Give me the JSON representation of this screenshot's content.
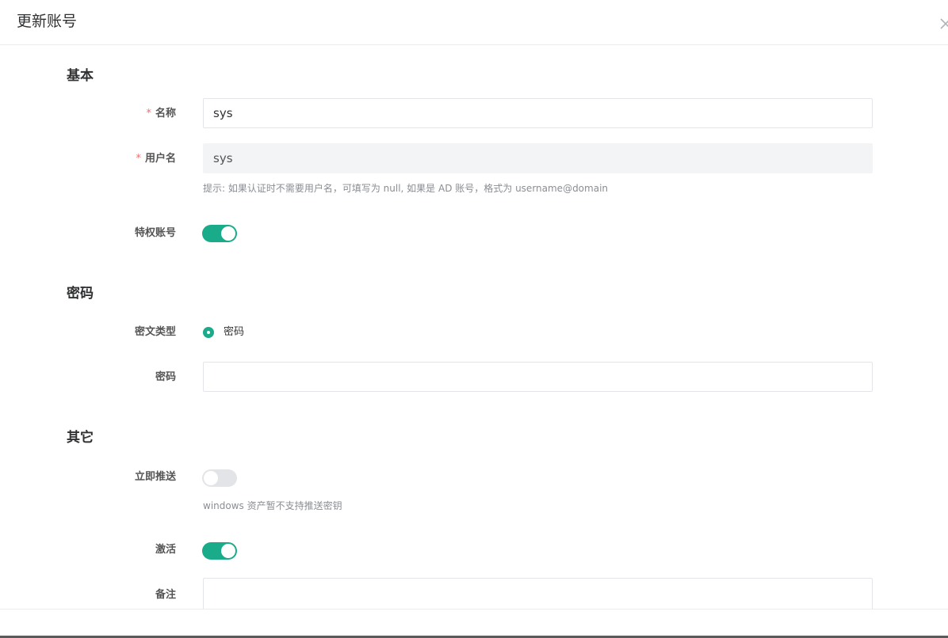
{
  "dialog": {
    "title": "更新账号"
  },
  "sections": {
    "basic": {
      "title": "基本",
      "name": {
        "label": "名称",
        "value": "sys",
        "required": "*"
      },
      "username": {
        "label": "用户名",
        "value": "sys",
        "required": "*",
        "hint": "提示: 如果认证时不需要用户名，可填写为 null, 如果是 AD 账号，格式为 username@domain"
      },
      "privileged": {
        "label": "特权账号",
        "on": true
      }
    },
    "password": {
      "title": "密码",
      "secret_type": {
        "label": "密文类型",
        "option": "密码"
      },
      "password": {
        "label": "密码",
        "value": ""
      }
    },
    "other": {
      "title": "其它",
      "push_now": {
        "label": "立即推送",
        "on": false,
        "hint": "windows 资产暂不支持推送密钥"
      },
      "active": {
        "label": "激活",
        "on": true
      },
      "comment": {
        "label": "备注",
        "value": ""
      }
    }
  },
  "colors": {
    "accent": "#1aab8a",
    "required": "#f56c6c",
    "switch_off": "#e3e4e8"
  }
}
